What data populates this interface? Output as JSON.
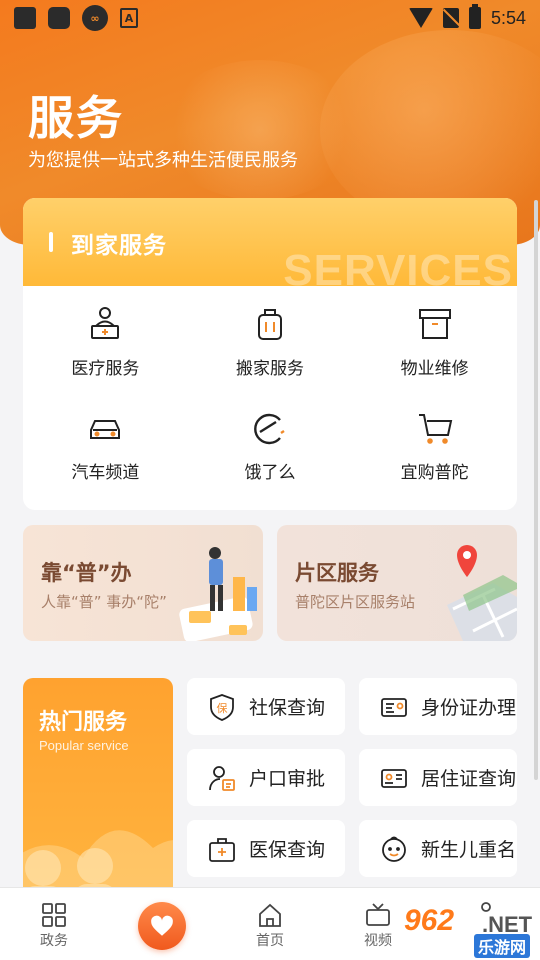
{
  "status_bar": {
    "time": "5:54"
  },
  "header": {
    "title": "服务",
    "subtitle": "为您提供一站式多种生活便民服务"
  },
  "home_service": {
    "title": "到家服务",
    "watermark": "SERVICES",
    "items": [
      {
        "label": "医疗服务",
        "icon": "medical-desk-icon"
      },
      {
        "label": "搬家服务",
        "icon": "luggage-icon"
      },
      {
        "label": "物业维修",
        "icon": "box-icon"
      },
      {
        "label": "汽车频道",
        "icon": "car-icon"
      },
      {
        "label": "饿了么",
        "icon": "eleme-icon"
      },
      {
        "label": "宜购普陀",
        "icon": "cart-icon"
      }
    ]
  },
  "banners": [
    {
      "title": "靠“普”办",
      "subtitle": "人靠“普” 事办“陀”"
    },
    {
      "title": "片区服务",
      "subtitle": "普陀区片区服务站"
    }
  ],
  "hot_services": {
    "title": "热门服务",
    "subtitle": "Popular service",
    "items": [
      {
        "label": "社保查询",
        "icon": "shield-bao-icon"
      },
      {
        "label": "身份证办理",
        "icon": "id-card-icon"
      },
      {
        "label": "户口审批",
        "icon": "person-doc-icon"
      },
      {
        "label": "居住证查询",
        "icon": "residence-card-icon"
      },
      {
        "label": "医保查询",
        "icon": "medical-kit-icon"
      },
      {
        "label": "新生儿重名",
        "icon": "baby-face-icon"
      }
    ]
  },
  "bottom_nav": [
    {
      "label": "政务",
      "icon": "grid-icon"
    },
    {
      "label": "",
      "icon": "heart-icon"
    },
    {
      "label": "首页",
      "icon": "home-icon"
    },
    {
      "label": "视频",
      "icon": "tv-icon"
    }
  ],
  "watermark_brand": {
    "number": "962",
    "suffix": ".NET",
    "sub": "乐游网"
  },
  "colors": {
    "accent": "#f08a2a",
    "hot_orange": "#ffa22f",
    "fab": "#f05a1e"
  }
}
